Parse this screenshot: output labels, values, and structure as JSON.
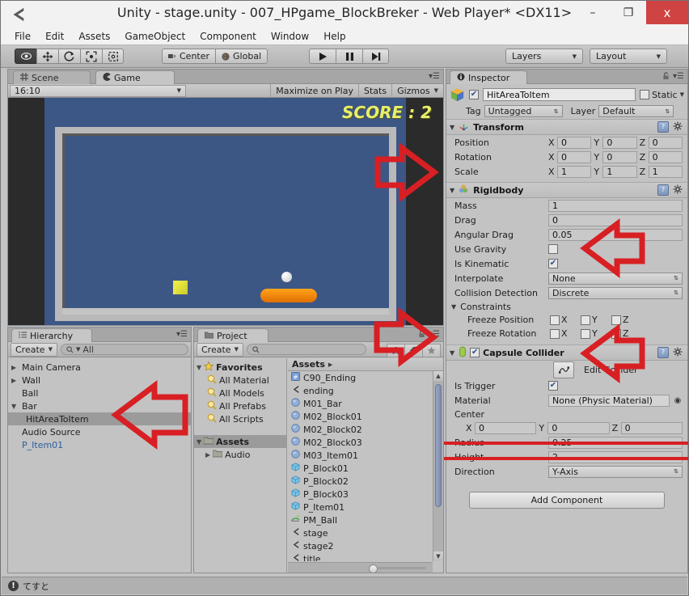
{
  "window": {
    "title": "Unity - stage.unity - 007_HPgame_BlockBreker - Web Player* <DX11>",
    "minimize": "–",
    "restore": "❐",
    "close": "x"
  },
  "menu": [
    "File",
    "Edit",
    "Assets",
    "GameObject",
    "Component",
    "Window",
    "Help"
  ],
  "toolbar": {
    "tools": [
      "hand-tool",
      "move-tool",
      "rotate-tool",
      "scale-tool",
      "rect-tool"
    ],
    "pivot_mode": "Center",
    "pivot_rotation": "Global",
    "play": "▶",
    "pause": "▐▐",
    "step": "▶|",
    "layers": "Layers",
    "layout": "Layout"
  },
  "game_view": {
    "tabs": [
      {
        "label": "Scene",
        "active": false
      },
      {
        "label": "Game",
        "active": true
      }
    ],
    "aspect": "16:10",
    "maximize_on_play": "Maximize on Play",
    "stats": "Stats",
    "gizmos": "Gizmos",
    "score_text": "SCORE : 2"
  },
  "hierarchy": {
    "tab": "Hierarchy",
    "create": "Create",
    "search_placeholder": "All",
    "items": [
      {
        "label": "Main Camera",
        "arrow": "▶",
        "indent": 0,
        "selected": false,
        "prefab": false
      },
      {
        "label": "Wall",
        "arrow": "▶",
        "indent": 0,
        "selected": false,
        "prefab": false
      },
      {
        "label": "Ball",
        "arrow": "",
        "indent": 0,
        "selected": false,
        "prefab": false
      },
      {
        "label": "Bar",
        "arrow": "▼",
        "indent": 0,
        "selected": false,
        "prefab": false
      },
      {
        "label": "HitAreaToItem",
        "arrow": "",
        "indent": 1,
        "selected": true,
        "prefab": false
      },
      {
        "label": "Audio Source",
        "arrow": "",
        "indent": 0,
        "selected": false,
        "prefab": false
      },
      {
        "label": "P_Item01",
        "arrow": "",
        "indent": 0,
        "selected": false,
        "prefab": true
      }
    ]
  },
  "project": {
    "tab": "Project",
    "create": "Create",
    "search_placeholder": "",
    "favorites_label": "Favorites",
    "favorites": [
      "All Material",
      "All Models",
      "All Prefabs",
      "All Scripts"
    ],
    "assets_label": "Assets",
    "folders": [
      "Audio"
    ],
    "breadcrumb": "Assets",
    "files": [
      {
        "name": "C90_Ending",
        "icon": "script-icon"
      },
      {
        "name": "ending",
        "icon": "scene-icon"
      },
      {
        "name": "M01_Bar",
        "icon": "material-icon"
      },
      {
        "name": "M02_Block01",
        "icon": "material-icon"
      },
      {
        "name": "M02_Block02",
        "icon": "material-icon"
      },
      {
        "name": "M02_Block03",
        "icon": "material-icon"
      },
      {
        "name": "M03_Item01",
        "icon": "material-icon"
      },
      {
        "name": "P_Block01",
        "icon": "prefab-icon"
      },
      {
        "name": "P_Block02",
        "icon": "prefab-icon"
      },
      {
        "name": "P_Block03",
        "icon": "prefab-icon"
      },
      {
        "name": "P_Item01",
        "icon": "prefab-icon"
      },
      {
        "name": "PM_Ball",
        "icon": "physic-material-icon"
      },
      {
        "name": "stage",
        "icon": "scene-icon"
      },
      {
        "name": "stage2",
        "icon": "scene-icon"
      },
      {
        "name": "title",
        "icon": "scene-icon"
      }
    ]
  },
  "inspector": {
    "tab": "Inspector",
    "object_name": "HitAreaToItem",
    "enabled": true,
    "static_label": "Static",
    "static_checked": false,
    "tag_label": "Tag",
    "tag_value": "Untagged",
    "layer_label": "Layer",
    "layer_value": "Default",
    "transform": {
      "title": "Transform",
      "position": {
        "label": "Position",
        "x": "0",
        "y": "0",
        "z": "0"
      },
      "rotation": {
        "label": "Rotation",
        "x": "0",
        "y": "0",
        "z": "0"
      },
      "scale": {
        "label": "Scale",
        "x": "1",
        "y": "1",
        "z": "1"
      }
    },
    "rigidbody": {
      "title": "Rigidbody",
      "mass": {
        "label": "Mass",
        "value": "1"
      },
      "drag": {
        "label": "Drag",
        "value": "0"
      },
      "angular_drag": {
        "label": "Angular Drag",
        "value": "0.05"
      },
      "use_gravity": {
        "label": "Use Gravity",
        "checked": false
      },
      "is_kinematic": {
        "label": "Is Kinematic",
        "checked": true
      },
      "interpolate": {
        "label": "Interpolate",
        "value": "None"
      },
      "collision_detection": {
        "label": "Collision Detection",
        "value": "Discrete"
      },
      "constraints_label": "Constraints",
      "freeze_position": {
        "label": "Freeze Position",
        "x": "X",
        "y": "Y",
        "z": "Z"
      },
      "freeze_rotation": {
        "label": "Freeze Rotation",
        "x": "X",
        "y": "Y",
        "z": "Z"
      }
    },
    "capsule_collider": {
      "title": "Capsule Collider",
      "enabled": true,
      "edit_collider": "Edit Collider",
      "is_trigger": {
        "label": "Is Trigger",
        "checked": true
      },
      "material": {
        "label": "Material",
        "value": "None (Physic Material)"
      },
      "center": {
        "label": "Center",
        "x": "0",
        "y": "0",
        "z": "0"
      },
      "radius": {
        "label": "Radius",
        "value": "0.25"
      },
      "height": {
        "label": "Height",
        "value": "2"
      },
      "direction": {
        "label": "Direction",
        "value": "Y-Axis"
      }
    },
    "add_component": "Add Component"
  },
  "status_bar": {
    "message": "てすと"
  },
  "colors": {
    "annotation_red": "#d81f23",
    "sky_blue": "#3c5685",
    "score_yellow": "#e8ef6a",
    "paddle_orange": "#ef8a00",
    "prefab_blue": "#2c5f9e"
  }
}
